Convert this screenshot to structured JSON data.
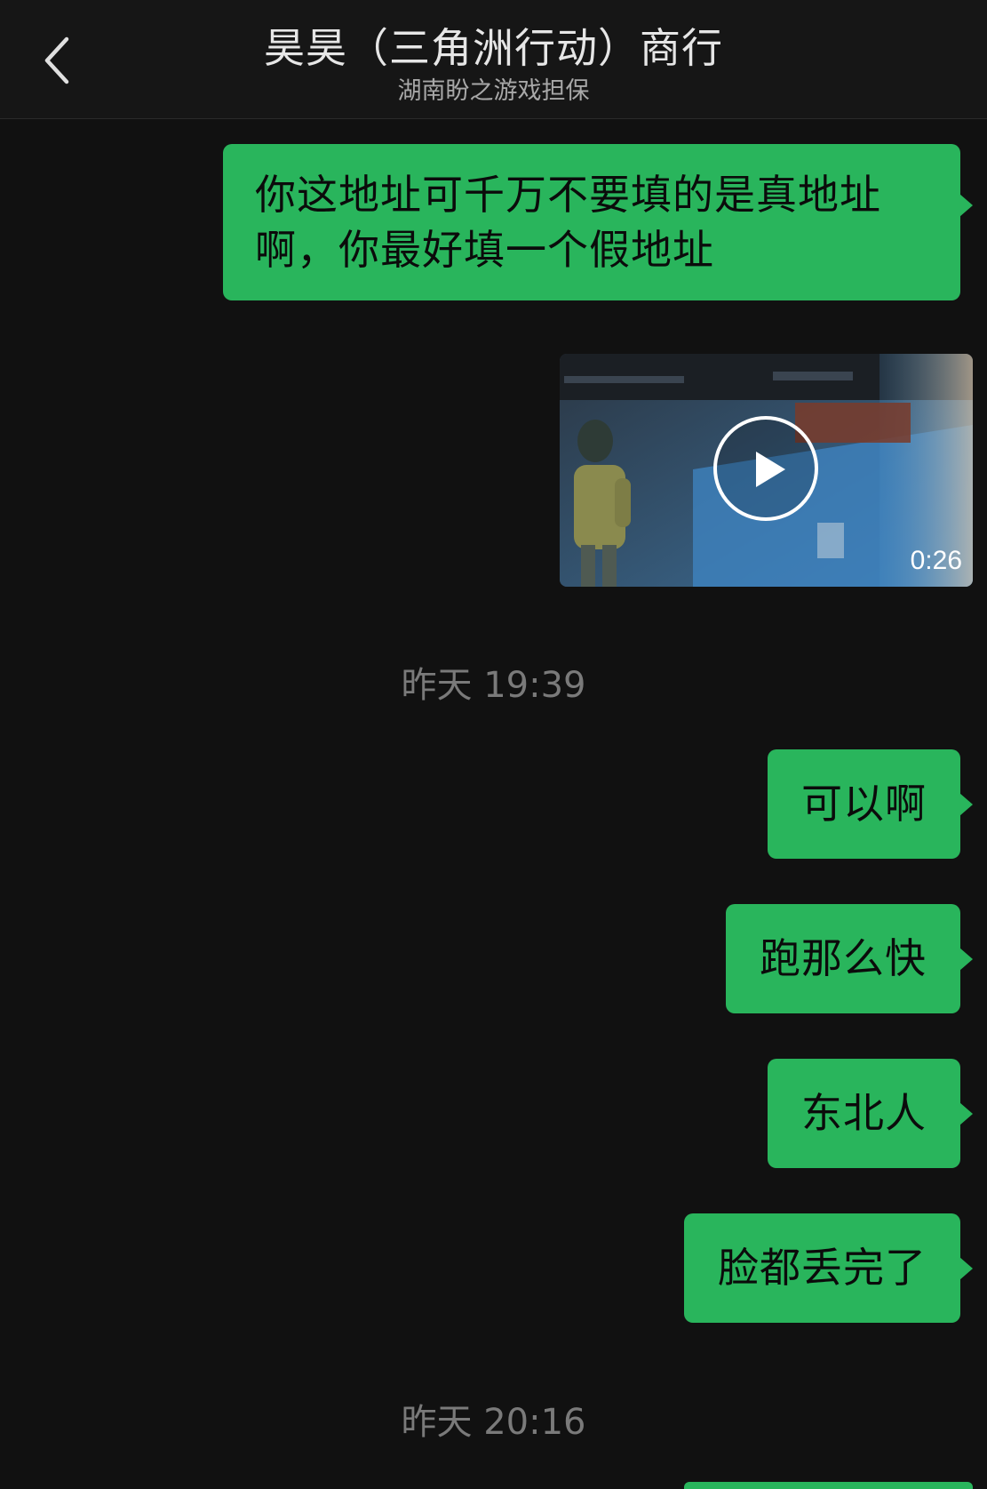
{
  "header": {
    "title": "昊昊（三角洲行动）商行",
    "subtitle": "湖南盼之游戏担保"
  },
  "messages": [
    {
      "text": "你这地址可千万不要填的是真地址啊，你最好填一个假地址"
    },
    {
      "video_duration": "0:26"
    },
    {
      "text": "可以啊"
    },
    {
      "text": "跑那么快"
    },
    {
      "text": "东北人"
    },
    {
      "text": "脸都丢完了"
    }
  ],
  "timestamps": [
    "昨天 19:39",
    "昨天 20:16"
  ],
  "colors": {
    "background": "#111111",
    "bubble_green": "#29b55c",
    "timestamp_gray": "#7a7a7a"
  },
  "icons": {
    "back": "chevron-left-icon",
    "play": "play-icon"
  }
}
